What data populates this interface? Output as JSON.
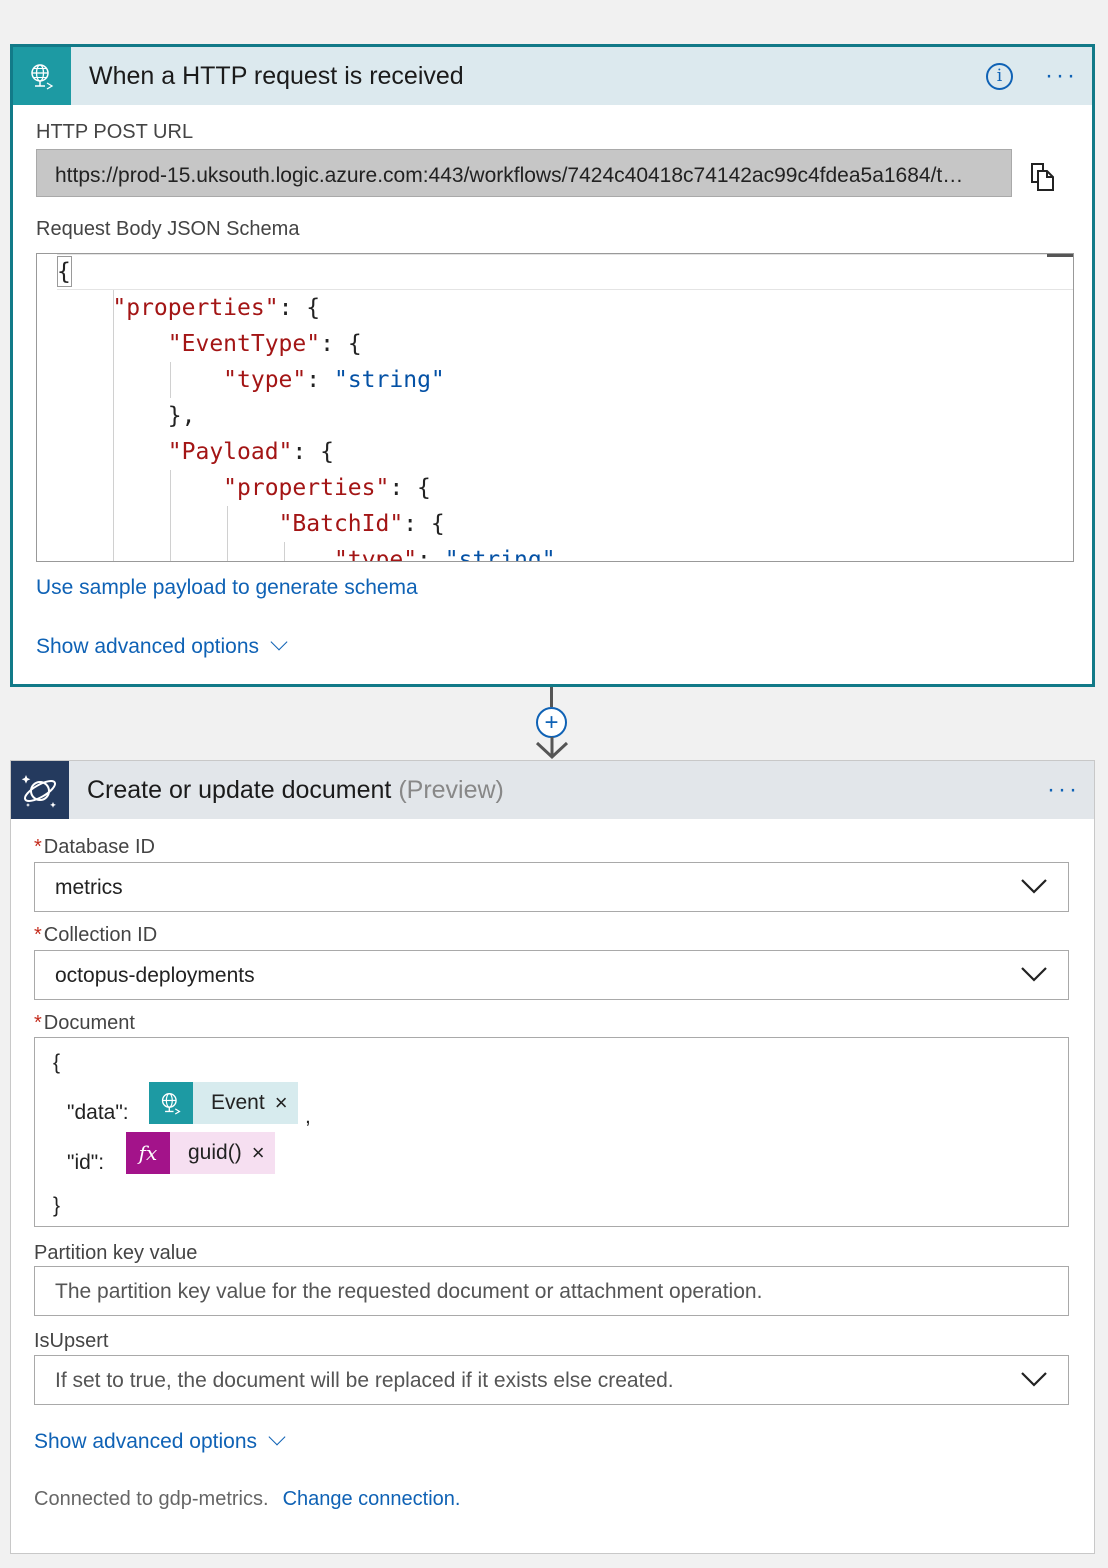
{
  "trigger_card": {
    "title": "When a HTTP request is received",
    "url_label": "HTTP POST URL",
    "url_value": "https://prod-15.uksouth.logic.azure.com:443/workflows/7424c40418c74142ac99c4fdea5a1684/t…",
    "schema_label": "Request Body JSON Schema",
    "schema_lines": [
      "{",
      "    \"properties\": {",
      "        \"EventType\": {",
      "            \"type\": \"string\"",
      "        },",
      "        \"Payload\": {",
      "            \"properties\": {",
      "                \"BatchId\": {",
      "                    \"type\": \"string\""
    ],
    "sample_payload_link": "Use sample payload to generate schema",
    "advanced_link": "Show advanced options"
  },
  "action_card": {
    "title": "Create or update document",
    "title_suffix": "(Preview)",
    "database_label": "Database ID",
    "database_value": "metrics",
    "collection_label": "Collection ID",
    "collection_value": "octopus-deployments",
    "document_label": "Document",
    "document": {
      "open_brace": "{",
      "data_key": "\"data\":",
      "data_token": "Event",
      "data_comma": ",",
      "id_key": "\"id\":",
      "id_token": "guid()",
      "id_token_icon": "fx",
      "close_brace": "}"
    },
    "partition_label": "Partition key value",
    "partition_placeholder": "The partition key value for the requested document or attachment operation.",
    "upsert_label": "IsUpsert",
    "upsert_placeholder": "If set to true, the document will be replaced if it exists else created.",
    "advanced_link": "Show advanced options",
    "connected_text": "Connected to gdp-metrics.",
    "change_connection_link": "Change connection."
  },
  "required_marker": "*",
  "close_glyph": "×",
  "add_step_glyph": "+",
  "info_glyph": "i",
  "more_glyph": "···",
  "colors": {
    "accent": "#0f62b5",
    "trigger_teal": "#1d9aa3",
    "cosmos_navy": "#243a5e",
    "fx_magenta": "#a3138a",
    "required_red": "#c42b1c"
  },
  "icons": [
    "http-globe-icon",
    "cosmos-planet-icon",
    "info-icon",
    "more-options-icon",
    "copy-icon",
    "add-step-icon",
    "chevron-down-icon",
    "fx-icon"
  ]
}
